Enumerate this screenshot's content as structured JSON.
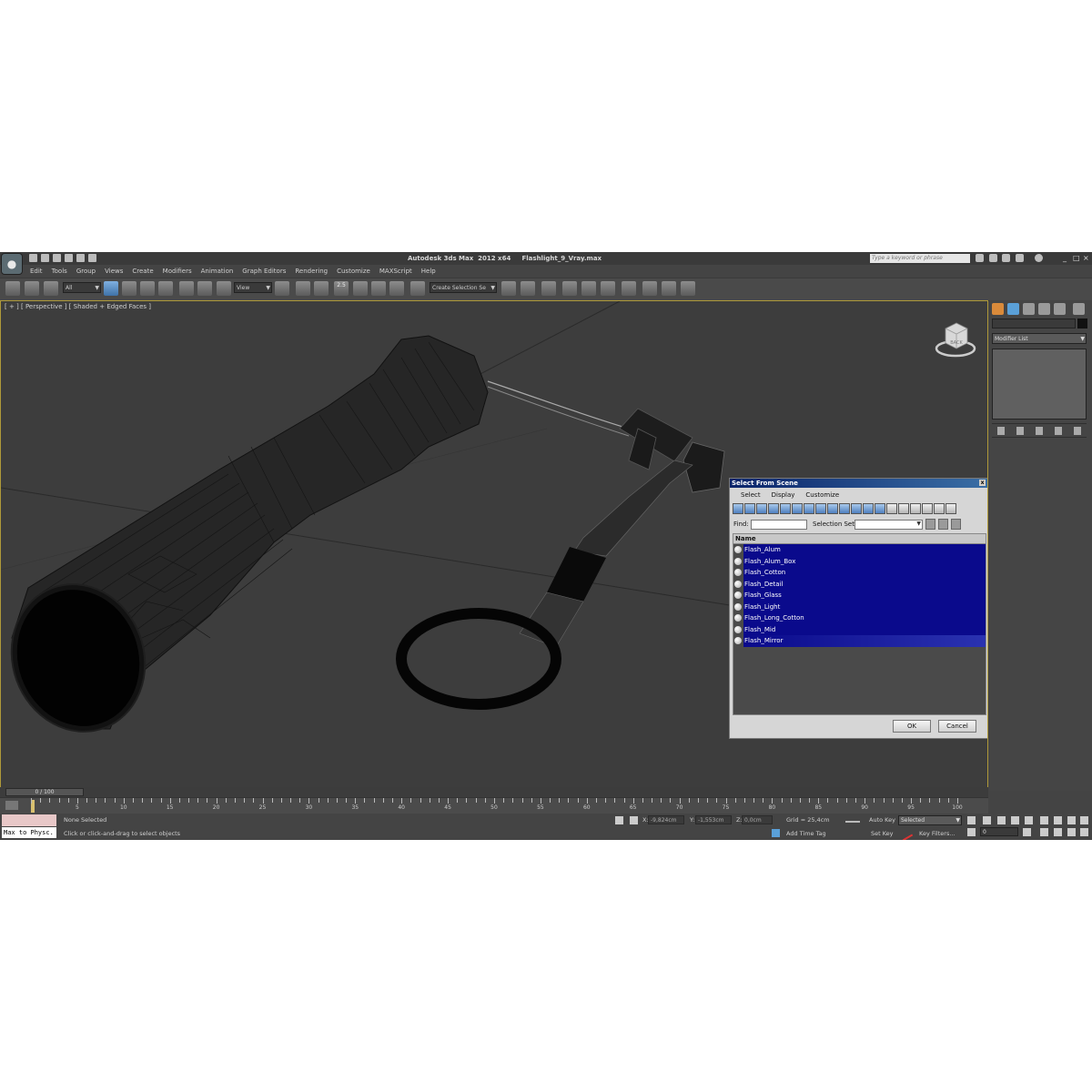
{
  "window": {
    "app_title": "Autodesk 3ds Max  2012 x64",
    "file_title": "Flashlight_9_Vray.max",
    "search_placeholder": "Type a keyword or phrase"
  },
  "menu": [
    "Edit",
    "Tools",
    "Group",
    "Views",
    "Create",
    "Modifiers",
    "Animation",
    "Graph Editors",
    "Rendering",
    "Customize",
    "MAXScript",
    "Help"
  ],
  "toolbar": {
    "filter_value": "All",
    "ref_coord_value": "View",
    "snap_label": "2.5",
    "named_selection_value": "Create Selection Se"
  },
  "viewport": {
    "label": "[ + ] [ Perspective ] [ Shaded + Edged Faces ]",
    "viewcube_label": "BACK"
  },
  "command_panel": {
    "modifier_list_label": "Modifier List"
  },
  "dialog": {
    "title": "Select From Scene",
    "close_label": "x",
    "menu": [
      "Select",
      "Display",
      "Customize"
    ],
    "find_label": "Find:",
    "selection_set_label": "Selection Set:",
    "column_header": "Name",
    "items": [
      "Flash_Alum",
      "Flash_Alum_Box",
      "Flash_Cotton",
      "Flash_Detail",
      "Flash_Glass",
      "Flash_Light",
      "Flash_Long_Cotton",
      "Flash_Mid",
      "Flash_Mirror"
    ],
    "ok_label": "OK",
    "cancel_label": "Cancel"
  },
  "timeline": {
    "frame_counter": "0 / 100",
    "ticks": [
      "5",
      "10",
      "15",
      "20",
      "25",
      "30",
      "35",
      "40",
      "45",
      "50",
      "55",
      "60",
      "65",
      "70",
      "75",
      "80",
      "85",
      "90",
      "95",
      "100"
    ]
  },
  "status": {
    "listener_text": "Max to Physc.",
    "selection_status": "None Selected",
    "prompt": "Click or click-and-drag to select objects",
    "x_label": "X:",
    "x_value": "-9,824cm",
    "y_label": "Y:",
    "y_value": "-1,553cm",
    "z_label": "Z:",
    "z_value": "0,0cm",
    "grid": "Grid = 25,4cm",
    "add_time_tag": "Add Time Tag",
    "auto_key": "Auto Key",
    "set_key": "Set Key",
    "key_mode_value": "Selected",
    "key_filters": "Key Filters...",
    "current_frame": "0"
  }
}
